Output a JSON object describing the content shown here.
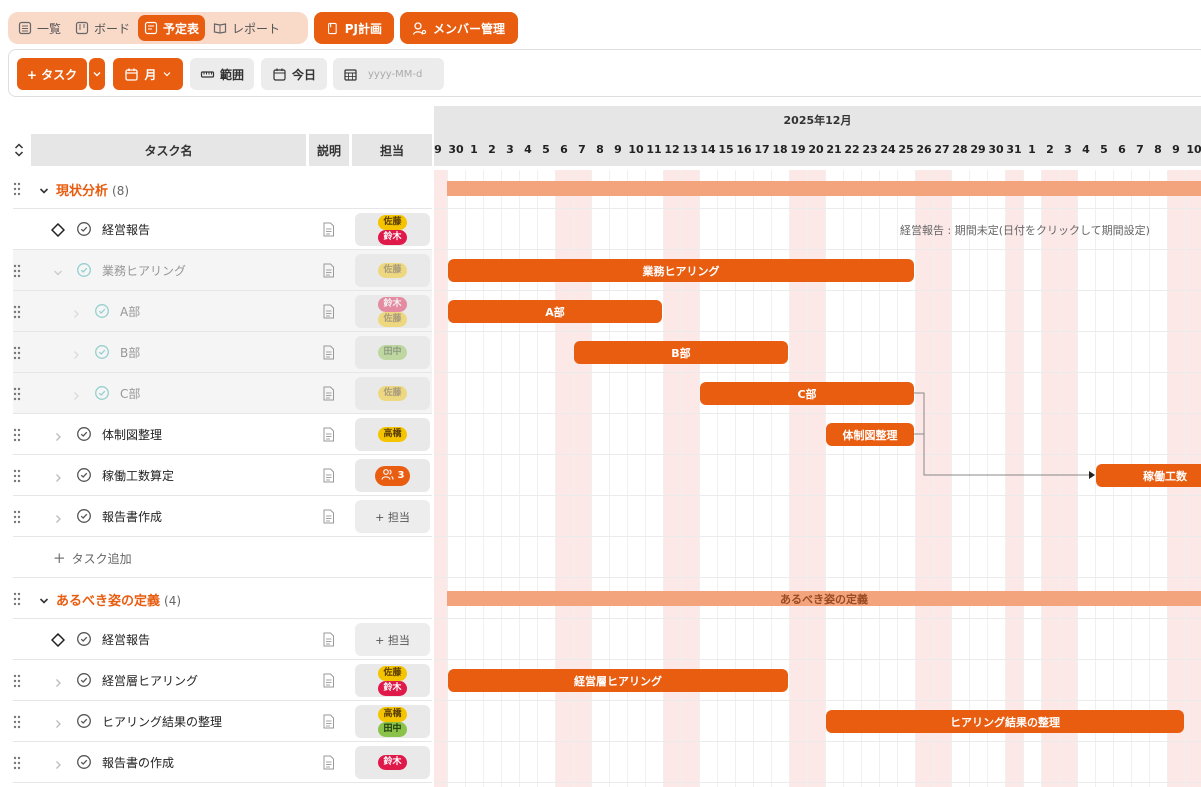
{
  "view_tabs": [
    {
      "label": "一覧",
      "icon": "list-icon",
      "active": false
    },
    {
      "label": "ボード",
      "icon": "board-icon",
      "active": false
    },
    {
      "label": "予定表",
      "icon": "schedule-icon",
      "active": true
    },
    {
      "label": "レポート",
      "icon": "report-icon",
      "active": false
    }
  ],
  "top_buttons": {
    "project_plan": "PJ計画",
    "member_manage": "メンバー管理"
  },
  "toolbar": {
    "add_task": "+ タスク",
    "scale": "月",
    "range": "範囲",
    "today": "今日",
    "date_placeholder": "yyyy-MM-d"
  },
  "columns": {
    "task_name": "タスク名",
    "description": "説明",
    "assignee": "担当"
  },
  "timeline": {
    "month_label": "2025年12月",
    "day_labels": [
      "9",
      "30",
      "1",
      "2",
      "3",
      "4",
      "5",
      "6",
      "7",
      "8",
      "9",
      "10",
      "11",
      "12",
      "13",
      "14",
      "15",
      "16",
      "17",
      "18",
      "19",
      "20",
      "21",
      "22",
      "23",
      "24",
      "25",
      "26",
      "27",
      "28",
      "29",
      "30",
      "31",
      "1",
      "2",
      "3",
      "4",
      "5",
      "6",
      "7",
      "8",
      "9",
      "10"
    ]
  },
  "groups": [
    {
      "name": "現状分析",
      "count": "(8)",
      "bar_label": ""
    },
    {
      "name": "あるべき姿の定義",
      "count": "(4)",
      "bar_label": "あるべき姿の定義"
    }
  ],
  "tasks": [
    {
      "name": "経営報告",
      "note": "経営報告 : 期間未定(日付をクリックして期間設定)"
    },
    {
      "name": "業務ヒアリング",
      "bar_label": "業務ヒアリング"
    },
    {
      "name": "A部",
      "bar_label": "A部"
    },
    {
      "name": "B部",
      "bar_label": "B部"
    },
    {
      "name": "C部",
      "bar_label": "C部"
    },
    {
      "name": "体制図整理",
      "bar_label": "体制図整理"
    },
    {
      "name": "稼働工数算定",
      "bar_label": "稼働工数",
      "assignee_count": "3"
    },
    {
      "name": "報告書作成",
      "assign_label": "+ 担当"
    },
    {
      "name": "経営報告",
      "assign_label": "+ 担当"
    },
    {
      "name": "経営層ヒアリング",
      "bar_label": "経営層ヒアリング"
    },
    {
      "name": "ヒアリング結果の整理",
      "bar_label": "ヒアリング結果の整理"
    },
    {
      "name": "報告書の作成"
    }
  ],
  "add_task_label": "タスク追加",
  "members": {
    "sato": "佐藤",
    "suzuki": "鈴木",
    "tanaka": "田中",
    "takahashi": "高橋"
  },
  "colors": {
    "accent": "#e85d10",
    "weekend": "#fde8e8",
    "group_bar": "#f3a47c"
  }
}
